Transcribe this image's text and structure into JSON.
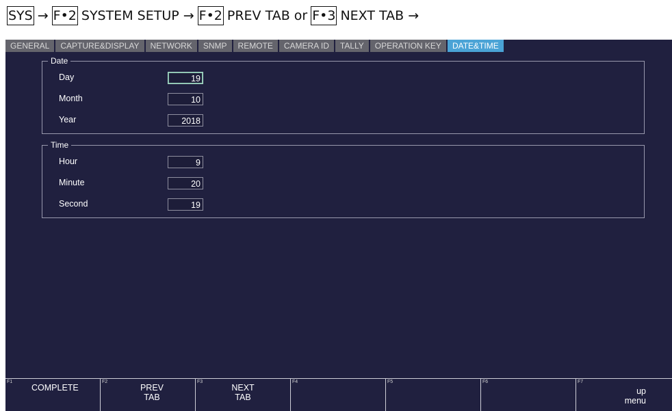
{
  "breadcrumb": {
    "k1": "SYS",
    "arrow1": "→",
    "k2": "F•2",
    "t2": "SYSTEM SETUP →",
    "k3": "F•2",
    "t3": "PREV TAB or",
    "k4": "F•3",
    "t4": "NEXT TAB →"
  },
  "tabs": [
    {
      "label": "GENERAL"
    },
    {
      "label": "CAPTURE&DISPLAY"
    },
    {
      "label": "NETWORK"
    },
    {
      "label": "SNMP"
    },
    {
      "label": "REMOTE"
    },
    {
      "label": "CAMERA ID"
    },
    {
      "label": "TALLY"
    },
    {
      "label": "OPERATION KEY"
    },
    {
      "label": "DATE&TIME",
      "active": true
    }
  ],
  "date_group": {
    "title": "Date",
    "fields": [
      {
        "label": "Day",
        "value": "19"
      },
      {
        "label": "Month",
        "value": "10"
      },
      {
        "label": "Year",
        "value": "2018"
      }
    ]
  },
  "time_group": {
    "title": "Time",
    "fields": [
      {
        "label": "Hour",
        "value": "9"
      },
      {
        "label": "Minute",
        "value": "20"
      },
      {
        "label": "Second",
        "value": "19"
      }
    ]
  },
  "fkeys": [
    {
      "num": "F1",
      "label": "COMPLETE"
    },
    {
      "num": "F2",
      "label": "PREV\nTAB"
    },
    {
      "num": "F3",
      "label": "NEXT\nTAB"
    },
    {
      "num": "F4",
      "label": ""
    },
    {
      "num": "F5",
      "label": ""
    },
    {
      "num": "F6",
      "label": ""
    },
    {
      "num": "F7",
      "label": "up\nmenu"
    }
  ]
}
